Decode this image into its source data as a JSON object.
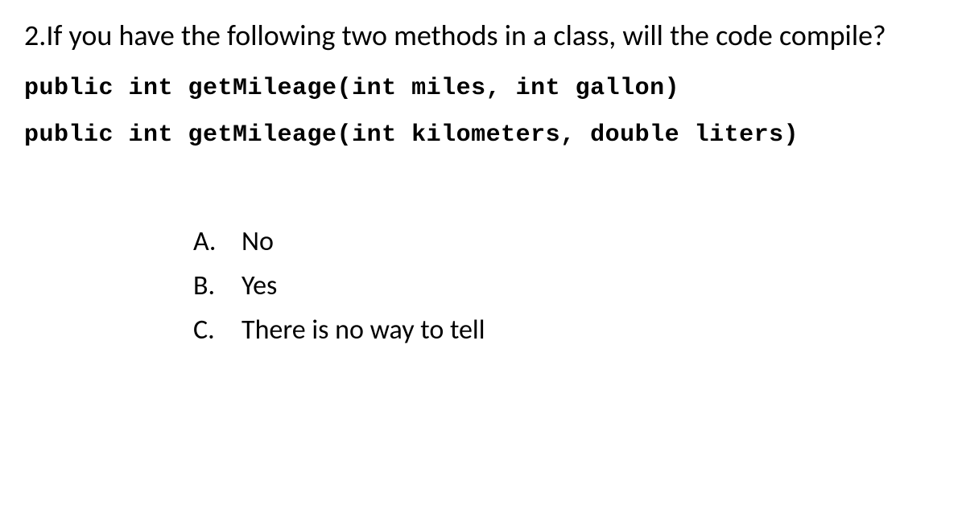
{
  "question": {
    "number": "2.",
    "text": "If you have the following two methods in a class, will the code compile?"
  },
  "code": {
    "line1": "public int getMileage(int miles, int gallon)",
    "line2": "public int getMileage(int kilometers, double liters)"
  },
  "options": [
    {
      "letter": "A.",
      "text": "No"
    },
    {
      "letter": "B.",
      "text": "Yes"
    },
    {
      "letter": "C.",
      "text": "There is no way to tell"
    }
  ]
}
